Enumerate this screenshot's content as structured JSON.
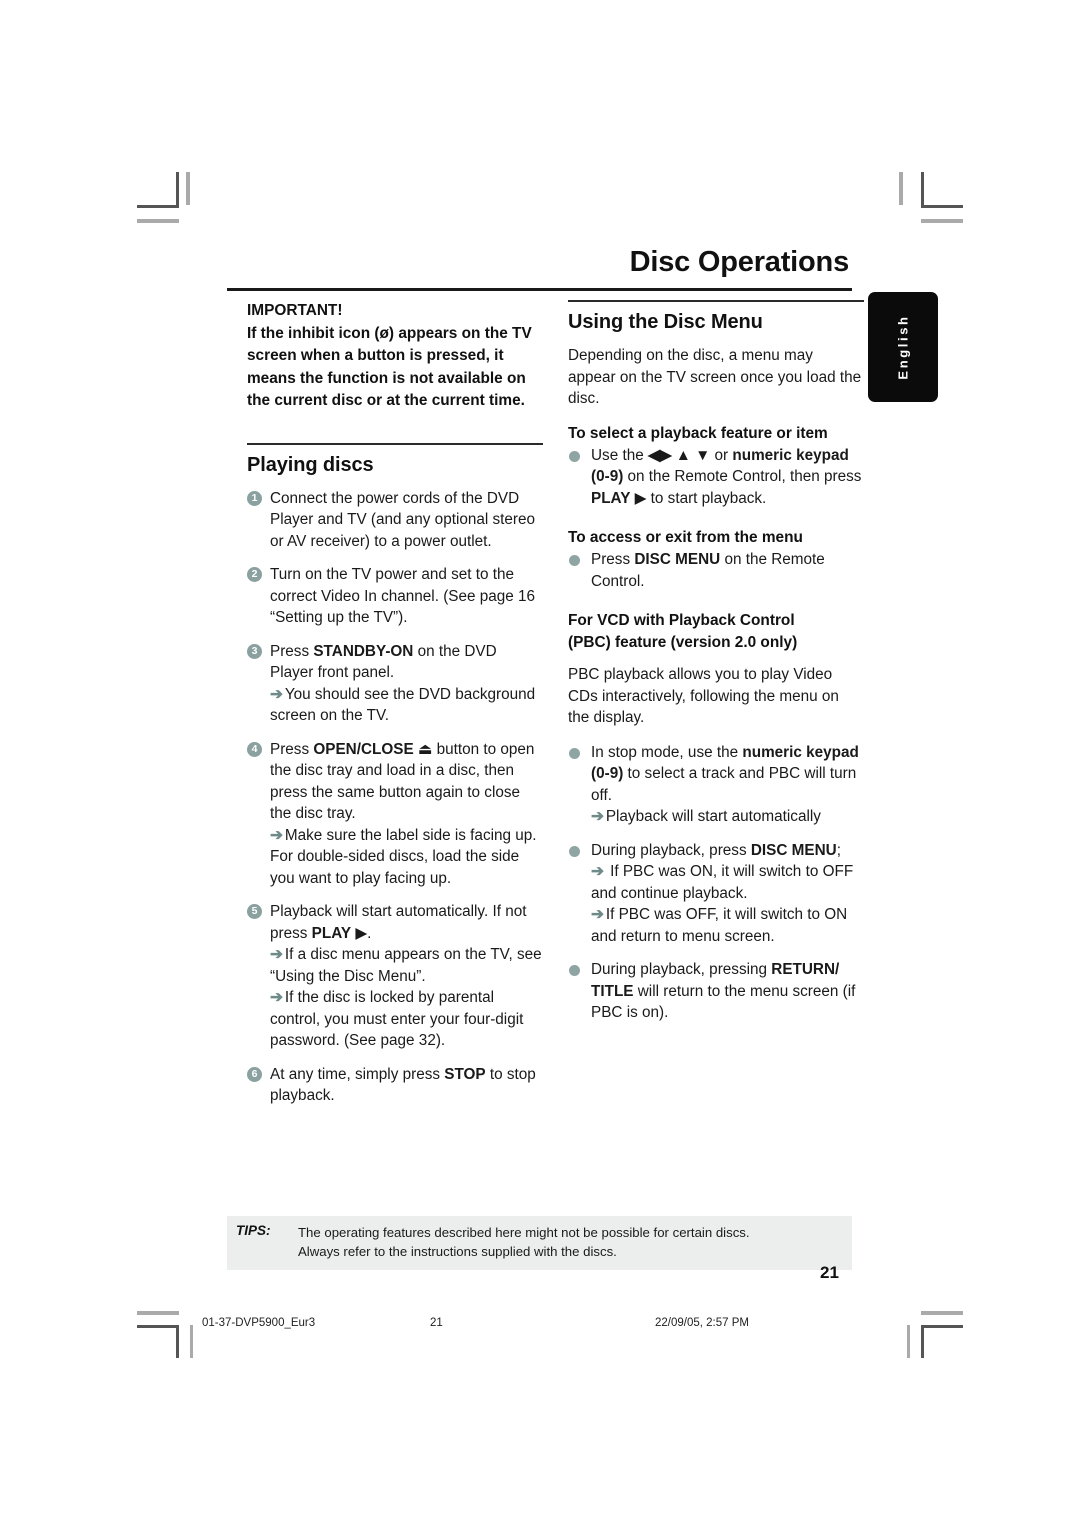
{
  "header": {
    "title": "Disc Operations",
    "language_tab": "English"
  },
  "left_column": {
    "important": {
      "label": "IMPORTANT!",
      "body": "If the inhibit icon (ø) appears on the TV screen when a button is pressed, it means the function is not available on the current disc or at the current time."
    },
    "section_title": "Playing discs",
    "steps": [
      {
        "number": "1",
        "text": "Connect the power cords of the DVD Player and TV (and any optional stereo or AV receiver) to a power outlet.",
        "notes": []
      },
      {
        "number": "2",
        "text": "Turn on the TV power and set to the correct Video In channel.  (See page 16 “Setting up the TV”).",
        "notes": []
      },
      {
        "number": "3",
        "text_before": "Press ",
        "bold": "STANDBY-ON",
        "text_after": " on the DVD Player front panel.",
        "notes": [
          "You should see the DVD background screen on the TV."
        ]
      },
      {
        "number": "4",
        "text_before": "Press ",
        "bold": "OPEN/CLOSE",
        "symbol": "⏏",
        "text_after": " button to open the disc tray and load in a disc, then press the same button again to close the disc tray.",
        "notes": [
          "Make sure the label side is facing up. For double-sided discs, load the side you want to play facing up."
        ]
      },
      {
        "number": "5",
        "text_before": "Playback will start automatically. If not press ",
        "bold": "PLAY",
        "symbol": "▶",
        "text_after": ".",
        "notes": [
          "If a disc menu appears on the TV, see “Using the Disc Menu”.",
          "If the disc is locked by parental control, you must enter your four-digit password. (See page 32)."
        ]
      },
      {
        "number": "6",
        "text_before": "At any time, simply press ",
        "bold": "STOP",
        "text_after": " to stop playback.",
        "notes": []
      }
    ]
  },
  "right_column": {
    "section_title": "Using the Disc Menu",
    "intro": "Depending on the disc, a menu may appear on the TV screen once you load the disc.",
    "subhead_select": "To select a playback feature or item",
    "bullet_select": {
      "p1": "Use the ",
      "arrows": "◀▶ ▲ ▼",
      "p2": " or ",
      "b1": "numeric keypad (0-9)",
      "p3": " on the Remote Control, then press ",
      "b2": "PLAY",
      "symbol": "▶",
      "p4": " to start playback."
    },
    "subhead_access": "To access or exit from the menu",
    "bullet_access": {
      "p1": "Press ",
      "b1": "DISC MENU",
      "p2": " on the Remote Control."
    },
    "subhead_pbc_line1": "For VCD with Playback Control",
    "subhead_pbc_line2": "(PBC) feature (version 2.0 only)",
    "pbc_intro": "PBC playback allows you to play Video CDs interactively, following the menu on the display.",
    "bullet_stopmode": {
      "p1": "In stop mode, use the ",
      "b1": "numeric keypad (0-9)",
      "p2": " to select a track and PBC will turn off.",
      "note": "Playback will start automatically"
    },
    "bullet_during": {
      "p1": "During playback, press ",
      "b1": "DISC MENU",
      "p2": ";",
      "note1": "If PBC was ON, it will switch to OFF and continue playback.",
      "note2": "If PBC was OFF, it will switch to ON and return to menu screen."
    },
    "bullet_return": {
      "p1": "During playback, pressing ",
      "b1": "RETURN/ TITLE",
      "p2": " will return to the menu screen (if PBC is on)."
    }
  },
  "tips": {
    "label": "TIPS:",
    "line1": "The operating features described here might not be possible for certain discs.",
    "line2": "Always refer to the instructions supplied with the discs."
  },
  "folio": "21",
  "printbar": {
    "file": "01-37-DVP5900_Eur3",
    "page": "21",
    "date": "22/09/05, 2:57 PM"
  },
  "colors": {
    "accent": "#8aa1a0",
    "arrow": "#6f8b89",
    "tips_bg": "#eceeee",
    "tab_bg": "#0b0b0b"
  }
}
